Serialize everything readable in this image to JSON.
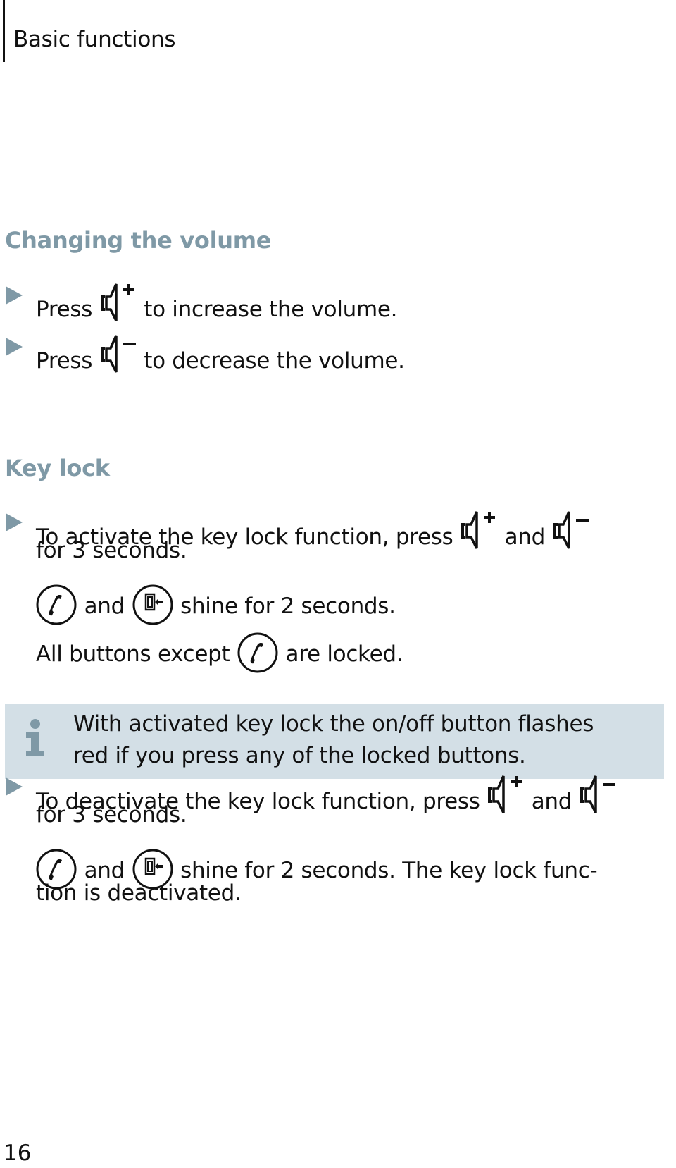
{
  "header": {
    "title": "Basic functions"
  },
  "sections": {
    "volume": {
      "heading": "Changing the volume",
      "items": [
        {
          "pre": "Press",
          "icon": "volume-up-icon",
          "post": "to increase the volume."
        },
        {
          "pre": "Press",
          "icon": "volume-down-icon",
          "post": "to decrease the volume."
        }
      ]
    },
    "keylock": {
      "heading": "Key lock",
      "activate": {
        "line1_pre": "To activate the key lock function, press",
        "and": "and",
        "line2": "for 3 seconds.",
        "line3_and": "and",
        "line3_post": "shine for 2 seconds.",
        "line4_pre": "All buttons except",
        "line4_post": "are locked."
      },
      "note": {
        "icon": "info-icon",
        "line1": "With activated key lock the on/off button flashes",
        "line2": "red if you press any of the locked buttons."
      },
      "deactivate": {
        "line1_pre": "To deactivate the key lock function, press",
        "and": "and",
        "line2": "for 3 seconds.",
        "line3_and": "and",
        "line3_post": "shine for 2 seconds. The key lock func-",
        "line4": "tion is deactivated."
      }
    }
  },
  "footer": {
    "page_number": "16"
  },
  "colors": {
    "heading": "#7f99a6",
    "bullet": "#7f99a6",
    "note_bg": "#d3dfe6",
    "note_icon": "#7f99a6"
  }
}
